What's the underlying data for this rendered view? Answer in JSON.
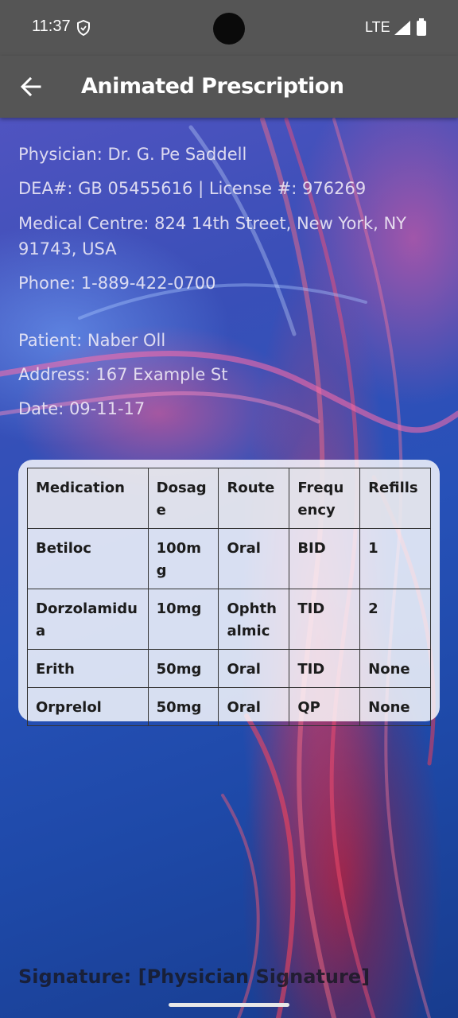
{
  "status_bar": {
    "time": "11:37",
    "network": "LTE"
  },
  "app_bar": {
    "title": "Animated Prescription"
  },
  "physician": {
    "name": "Physician: Dr. G. Pe Saddell",
    "dea_license": "DEA#: GB 05455616 | License #: 976269",
    "centre": "Medical Centre: 824 14th Street, New York, NY 91743, USA",
    "phone": "Phone: 1-889-422-0700"
  },
  "patient": {
    "name": "Patient: Naber Oll",
    "address": "Address: 167 Example St",
    "date": "Date: 09-11-17"
  },
  "table": {
    "headers": [
      "Medication",
      "Dosage",
      "Route",
      "Frequency",
      "Refills"
    ],
    "rows": [
      [
        "Betiloc",
        "100mg",
        "Oral",
        "BID",
        "1"
      ],
      [
        "Dorzolamidua",
        "10mg",
        "Ophthalmic",
        "TID",
        "2"
      ],
      [
        "Erith",
        "50mg",
        "Oral",
        "TID",
        "None"
      ],
      [
        "Orprelol",
        "50mg",
        "Oral",
        "QP",
        "None"
      ]
    ]
  },
  "signature": "Signature: [Physician Signature]",
  "icons": {
    "back": "arrow-back-icon",
    "shield": "shield-icon",
    "signal": "signal-icon",
    "battery": "battery-icon"
  },
  "colors": {
    "app_bar": "#555555",
    "text_light": "#f5f0f8",
    "card": "#ffffff"
  }
}
